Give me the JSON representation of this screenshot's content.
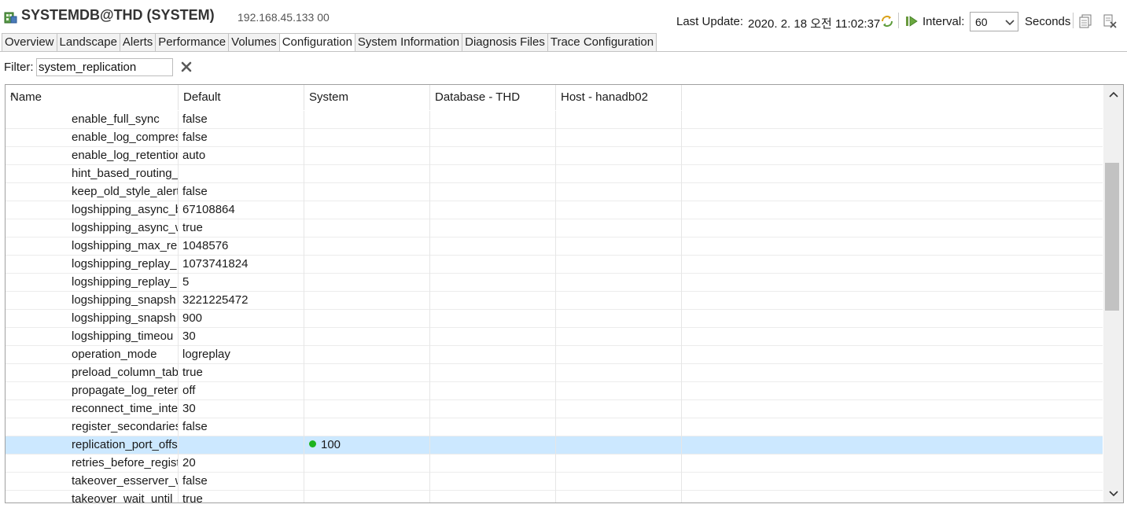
{
  "header": {
    "title": "SYSTEMDB@THD (SYSTEM)",
    "host_ip": "192.168.45.133 00",
    "last_update_label": "Last Update:",
    "last_update_value": "2020. 2. 18 오전 11:02:37",
    "interval_label": "Interval:",
    "interval_value": "60",
    "seconds_label": "Seconds"
  },
  "tabs": [
    {
      "label": "Overview"
    },
    {
      "label": "Landscape"
    },
    {
      "label": "Alerts"
    },
    {
      "label": "Performance"
    },
    {
      "label": "Volumes"
    },
    {
      "label": "Configuration",
      "active": true
    },
    {
      "label": "System Information"
    },
    {
      "label": "Diagnosis Files"
    },
    {
      "label": "Trace Configuration"
    }
  ],
  "filter": {
    "label": "Filter:",
    "value": "system_replication"
  },
  "table": {
    "columns": [
      "Name",
      "Default",
      "System",
      "Database - THD",
      "Host - hanadb02"
    ],
    "rows": [
      {
        "name": "enable_full_sync",
        "default": "false",
        "system": ""
      },
      {
        "name": "enable_log_compres",
        "default": "false",
        "system": ""
      },
      {
        "name": "enable_log_retention",
        "default": "auto",
        "system": ""
      },
      {
        "name": "hint_based_routing_",
        "default": "",
        "system": ""
      },
      {
        "name": "keep_old_style_alert",
        "default": "false",
        "system": ""
      },
      {
        "name": "logshipping_async_b",
        "default": "67108864",
        "system": ""
      },
      {
        "name": "logshipping_async_w",
        "default": "true",
        "system": ""
      },
      {
        "name": "logshipping_max_re",
        "default": "1048576",
        "system": ""
      },
      {
        "name": "logshipping_replay_",
        "default": "1073741824",
        "system": ""
      },
      {
        "name": "logshipping_replay_",
        "default": "5",
        "system": ""
      },
      {
        "name": "logshipping_snapsh",
        "default": "3221225472",
        "system": ""
      },
      {
        "name": "logshipping_snapsh",
        "default": "900",
        "system": ""
      },
      {
        "name": "logshipping_timeou",
        "default": "30",
        "system": ""
      },
      {
        "name": "operation_mode",
        "default": "logreplay",
        "system": ""
      },
      {
        "name": "preload_column_tab",
        "default": "true",
        "system": ""
      },
      {
        "name": "propagate_log_reter",
        "default": "off",
        "system": ""
      },
      {
        "name": "reconnect_time_inte",
        "default": "30",
        "system": ""
      },
      {
        "name": "register_secondaries",
        "default": "false",
        "system": ""
      },
      {
        "name": "replication_port_offs",
        "default": "",
        "system": "100",
        "selected": true,
        "system_status": "green-dot"
      },
      {
        "name": "retries_before_regist",
        "default": "20",
        "system": ""
      },
      {
        "name": "takeover_esserver_w",
        "default": "false",
        "system": ""
      },
      {
        "name": "takeover_wait_until_",
        "default": "true",
        "system": ""
      }
    ]
  },
  "colors": {
    "selected_row": "#cce8ff",
    "status_dot": "#1db31d"
  }
}
